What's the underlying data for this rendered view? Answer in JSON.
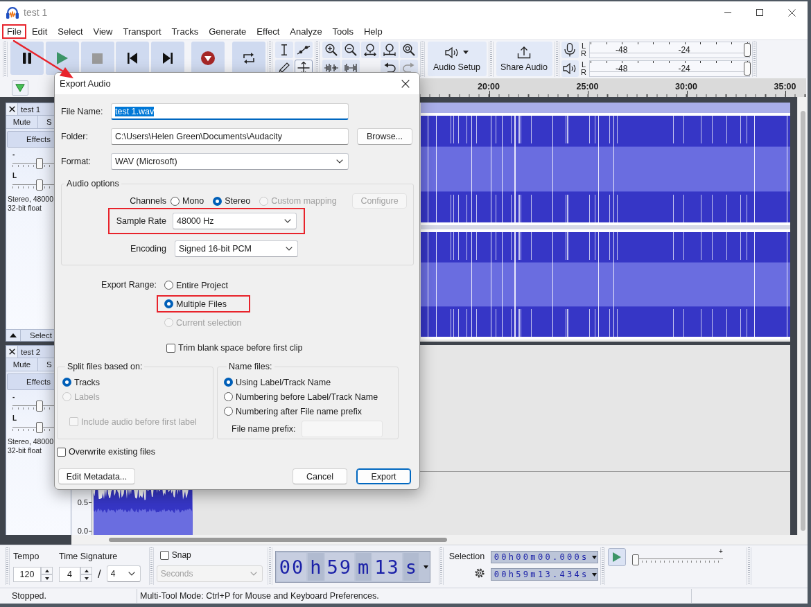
{
  "window": {
    "title": "test 1"
  },
  "menu": [
    {
      "label": "File",
      "highlighted": true
    },
    {
      "label": "Edit",
      "highlighted": false
    },
    {
      "label": "Select",
      "highlighted": false
    },
    {
      "label": "View",
      "highlighted": false
    },
    {
      "label": "Transport",
      "highlighted": false
    },
    {
      "label": "Tracks",
      "highlighted": false
    },
    {
      "label": "Generate",
      "highlighted": false
    },
    {
      "label": "Effect",
      "highlighted": false
    },
    {
      "label": "Analyze",
      "highlighted": false
    },
    {
      "label": "Tools",
      "highlighted": false
    },
    {
      "label": "Help",
      "highlighted": false
    }
  ],
  "callout_arrow": true,
  "toolbar": {
    "transport": [
      {
        "kind": "pause",
        "disabled": false
      },
      {
        "kind": "play",
        "disabled": false
      },
      {
        "kind": "stop",
        "disabled": true
      },
      {
        "kind": "skip_start",
        "disabled": false
      },
      {
        "kind": "skip_end",
        "disabled": false
      },
      {
        "kind": "record",
        "disabled": false
      },
      {
        "kind": "loop",
        "disabled": false
      }
    ],
    "tools": [
      {
        "kind": "select",
        "selected": false
      },
      {
        "kind": "envelope",
        "selected": false
      },
      {
        "kind": "draw",
        "selected": false
      },
      {
        "kind": "multi",
        "selected": true
      }
    ],
    "zoom_tools": [
      {
        "kind": "zoom_in",
        "disabled": false
      },
      {
        "kind": "zoom_out",
        "disabled": false
      },
      {
        "kind": "fit_selection",
        "disabled": false
      },
      {
        "kind": "fit_project",
        "disabled": false
      },
      {
        "kind": "zoom_toggle",
        "disabled": false
      }
    ],
    "edit_tools": [
      {
        "kind": "trim",
        "disabled": false
      },
      {
        "kind": "silence",
        "disabled": false
      }
    ],
    "history_tools": [
      {
        "kind": "undo",
        "disabled": false
      },
      {
        "kind": "redo",
        "disabled": true
      }
    ],
    "audio_setup": {
      "label": "Audio Setup"
    },
    "share_audio": {
      "label": "Share Audio"
    },
    "meters": [
      {
        "kind": "record",
        "channels": [
          "L",
          "R"
        ],
        "ticks": [
          "-48",
          "-24"
        ],
        "level": 1
      },
      {
        "kind": "playback",
        "channels": [
          "L",
          "R"
        ],
        "ticks": [
          "-48",
          "-24"
        ],
        "level": 1
      }
    ]
  },
  "timeline": {
    "labels": [
      "20:00",
      "25:00",
      "30:00",
      "35:00"
    ]
  },
  "tracks": [
    {
      "name": "test 1",
      "mute": "Mute",
      "solo": "S",
      "effects": "Effects",
      "sliders": [
        {
          "label": "-",
          "level": 0.5
        },
        {
          "label": "L",
          "level": 0.5
        }
      ],
      "info": [
        "Stereo, 48000",
        "32-bit float"
      ],
      "select": "Select"
    },
    {
      "name": "test 2",
      "mute": "Mute",
      "solo": "S",
      "effects": "Effects",
      "sliders": [
        {
          "label": "-",
          "level": 0.5
        },
        {
          "label": "L",
          "level": 0.5
        }
      ],
      "info": [
        "Stereo, 48000",
        "32-bit float"
      ],
      "scale": [
        "0.5",
        "0.0"
      ]
    }
  ],
  "bottom_toolbar": {
    "tempo": {
      "label": "Tempo",
      "value": "120"
    },
    "time_signature": {
      "label": "Time Signature",
      "upper": "4",
      "separator": "/",
      "lower": "4"
    },
    "snap": {
      "label": "Snap",
      "checked": false,
      "unit": "Seconds",
      "unit_disabled": true
    },
    "time": [
      {
        "kind": "digits",
        "text": "00"
      },
      {
        "kind": "unit",
        "text": "h"
      },
      {
        "kind": "digits",
        "text": "59"
      },
      {
        "kind": "unit",
        "text": "m"
      },
      {
        "kind": "digits",
        "text": "13"
      },
      {
        "kind": "unit",
        "text": "s"
      }
    ],
    "selection": {
      "label": "Selection",
      "start": "00h00m00.000s",
      "end": "00h59m13.434s"
    },
    "play_at_speed": {
      "level": 0.02,
      "max_label": "+"
    }
  },
  "status_bar": {
    "state": "Stopped.",
    "message": "Multi-Tool Mode: Ctrl+P for Mouse and Keyboard Preferences."
  },
  "export_dialog": {
    "title": "Export Audio",
    "file_name": {
      "label": "File Name:",
      "value": "test 1.wav",
      "value_selected": true
    },
    "folder": {
      "label": "Folder:",
      "value": "C:\\Users\\Helen Green\\Documents\\Audacity",
      "button": "Browse..."
    },
    "format": {
      "label": "Format:",
      "value": "WAV (Microsoft)"
    },
    "audio_options": {
      "title": "Audio options",
      "channels": {
        "label": "Channels",
        "options": [
          {
            "label": "Mono",
            "selected": false,
            "disabled": false
          },
          {
            "label": "Stereo",
            "selected": true,
            "disabled": false
          },
          {
            "label": "Custom mapping",
            "selected": false,
            "disabled": true
          }
        ],
        "button": {
          "label": "Configure",
          "disabled": true
        }
      },
      "sample_rate": {
        "label": "Sample Rate",
        "value": "48000 Hz",
        "highlighted": true
      },
      "encoding": {
        "label": "Encoding",
        "value": "Signed 16-bit PCM"
      }
    },
    "export_range": {
      "label": "Export Range:",
      "options": [
        {
          "label": "Entire Project",
          "selected": false,
          "disabled": false,
          "highlighted": false
        },
        {
          "label": "Multiple Files",
          "selected": true,
          "disabled": false,
          "highlighted": true
        },
        {
          "label": "Current selection",
          "selected": false,
          "disabled": true,
          "highlighted": false
        }
      ]
    },
    "trim": {
      "label": "Trim blank space before first clip",
      "checked": false
    },
    "split_files": {
      "title": "Split files based on:",
      "options": [
        {
          "label": "Tracks",
          "selected": true,
          "disabled": false
        },
        {
          "label": "Labels",
          "selected": false,
          "disabled": true
        }
      ],
      "include_audio": {
        "label": "Include audio before first label",
        "checked": false,
        "disabled": true
      }
    },
    "name_files": {
      "title": "Name files:",
      "options": [
        {
          "label": "Using Label/Track Name",
          "selected": true,
          "disabled": false
        },
        {
          "label": "Numbering before Label/Track Name",
          "selected": false,
          "disabled": false
        },
        {
          "label": "Numbering after File name prefix",
          "selected": false,
          "disabled": false
        }
      ],
      "prefix": {
        "label": "File name prefix:",
        "disabled": true
      }
    },
    "overwrite": {
      "label": "Overwrite existing files",
      "checked": false
    },
    "buttons": [
      {
        "label": "Edit Metadata...",
        "default": false
      },
      {
        "label": "Cancel",
        "default": false
      },
      {
        "label": "Export",
        "default": true
      }
    ]
  }
}
